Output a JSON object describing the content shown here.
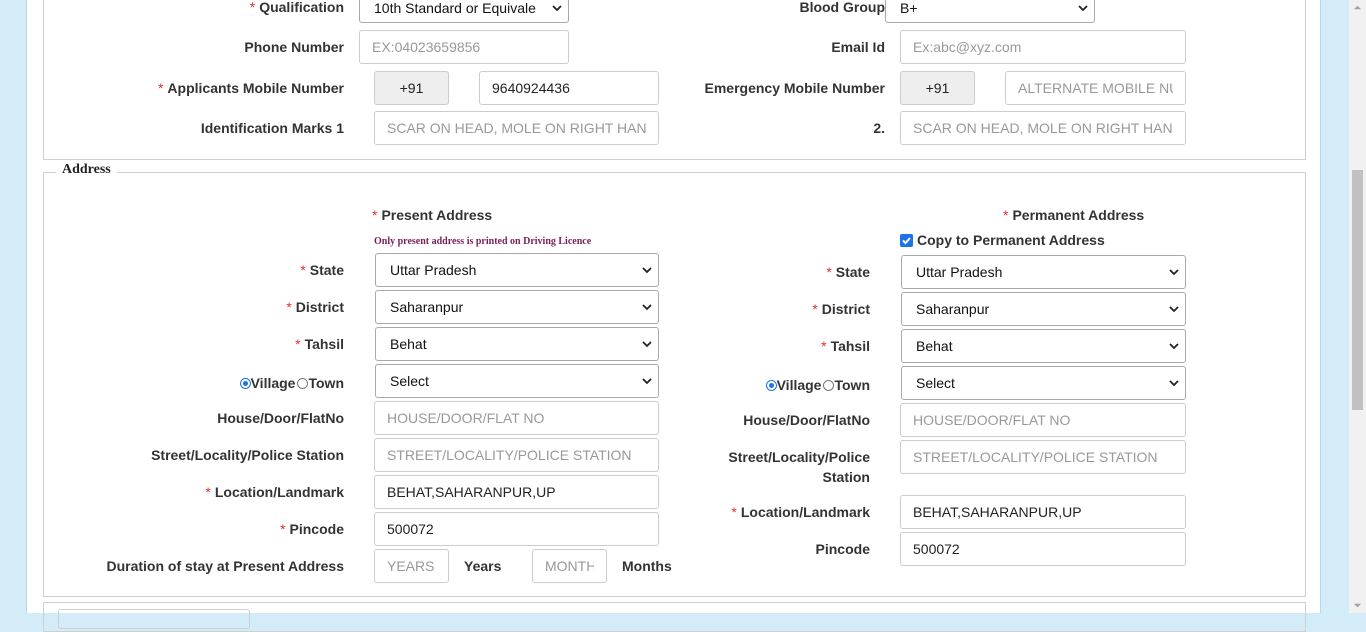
{
  "top": {
    "qualification": {
      "label": "Qualification",
      "value": "10th Standard or Equivale"
    },
    "blood_group": {
      "label": "Blood Group",
      "value": "B+"
    },
    "phone": {
      "label": "Phone Number",
      "placeholder": "EX:04023659856"
    },
    "email": {
      "label": "Email Id",
      "placeholder": "Ex:abc@xyz.com"
    },
    "mobile": {
      "label": "Applicants Mobile Number",
      "code": "+91",
      "value": "9640924436"
    },
    "emergency": {
      "label": "Emergency Mobile Number",
      "code": "+91",
      "placeholder": "ALTERNATE MOBILE NUMBER"
    },
    "marks1": {
      "label": "Identification Marks 1",
      "placeholder": "SCAR ON HEAD, MOLE ON RIGHT HAND"
    },
    "marks2": {
      "label": "2.",
      "placeholder": "SCAR ON HEAD, MOLE ON RIGHT HAND"
    }
  },
  "address": {
    "legend": "Address",
    "present": {
      "title": "Present Address",
      "note": "Only present address is printed on Driving Licence",
      "state_label": "State",
      "state": "Uttar Pradesh",
      "district_label": "District",
      "district": "Saharanpur",
      "tahsil_label": "Tahsil",
      "tahsil": "Behat",
      "village_label": "Village",
      "town_label": "Town",
      "vt_select": "Select",
      "house_label": "House/Door/FlatNo",
      "house_placeholder": "HOUSE/DOOR/FLAT NO",
      "street_label": "Street/Locality/Police Station",
      "street_placeholder": "STREET/LOCALITY/POLICE STATION",
      "location_label": "Location/Landmark",
      "location": "BEHAT,SAHARANPUR,UP",
      "pincode_label": "Pincode",
      "pincode": "500072",
      "duration_label": "Duration of stay at Present Address",
      "years_placeholder": "YEARS",
      "years_label": "Years",
      "months_placeholder": "MONTHS",
      "months_label": "Months"
    },
    "permanent": {
      "title": "Permanent Address",
      "copy_label": "Copy to Permanent Address",
      "state_label": "State",
      "state": "Uttar Pradesh",
      "district_label": "District",
      "district": "Saharanpur",
      "tahsil_label": "Tahsil",
      "tahsil": "Behat",
      "village_label": "Village",
      "town_label": "Town",
      "vt_select": "Select",
      "house_label": "House/Door/FlatNo",
      "house_placeholder": "HOUSE/DOOR/FLAT NO",
      "street_label_1": "Street/Locality/Police",
      "street_label_2": "Station",
      "street_placeholder": "STREET/LOCALITY/POLICE STATION",
      "location_label": "Location/Landmark",
      "location": "BEHAT,SAHARANPUR,UP",
      "pincode_label": "Pincode",
      "pincode": "500072"
    }
  },
  "colors": {
    "required": "#e0312e",
    "note": "#7a1f5a",
    "accent": "#1a73e8",
    "background": "#d3ecf7"
  }
}
